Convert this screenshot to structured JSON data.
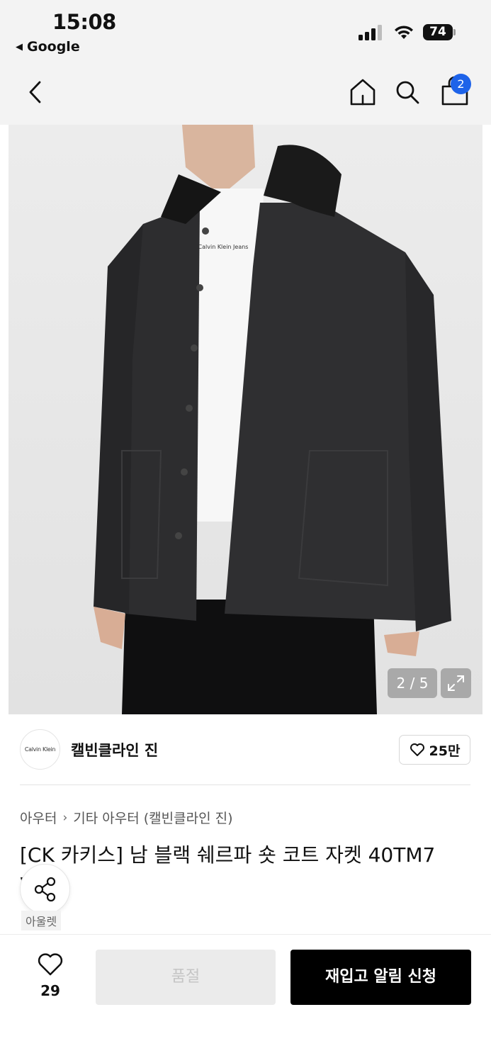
{
  "status_bar": {
    "time": "15:08",
    "back_app": "Google",
    "battery": "74"
  },
  "nav": {
    "cart_count": "2"
  },
  "gallery": {
    "counter": "2 / 5",
    "print_text": "Calvin Klein Jeans"
  },
  "brand": {
    "logo_text": "Calvin Klein",
    "name": "캘빈클라인 진",
    "like_count": "25만"
  },
  "product": {
    "breadcrumb": [
      "아우터",
      "기타 아우터 (캘빈클라인 진)"
    ],
    "title": "[CK 카키스] 남 블랙 쉐르파 숏 코트 자켓 40TM7  W7",
    "tag": "아울렛"
  },
  "bottom": {
    "wish_count": "29",
    "soldout_label": "품절",
    "restock_label": "재입고 알림 신청"
  },
  "colors": {
    "badge": "#1e63e9",
    "primary_button": "#000000",
    "disabled_button": "#ebebeb"
  }
}
